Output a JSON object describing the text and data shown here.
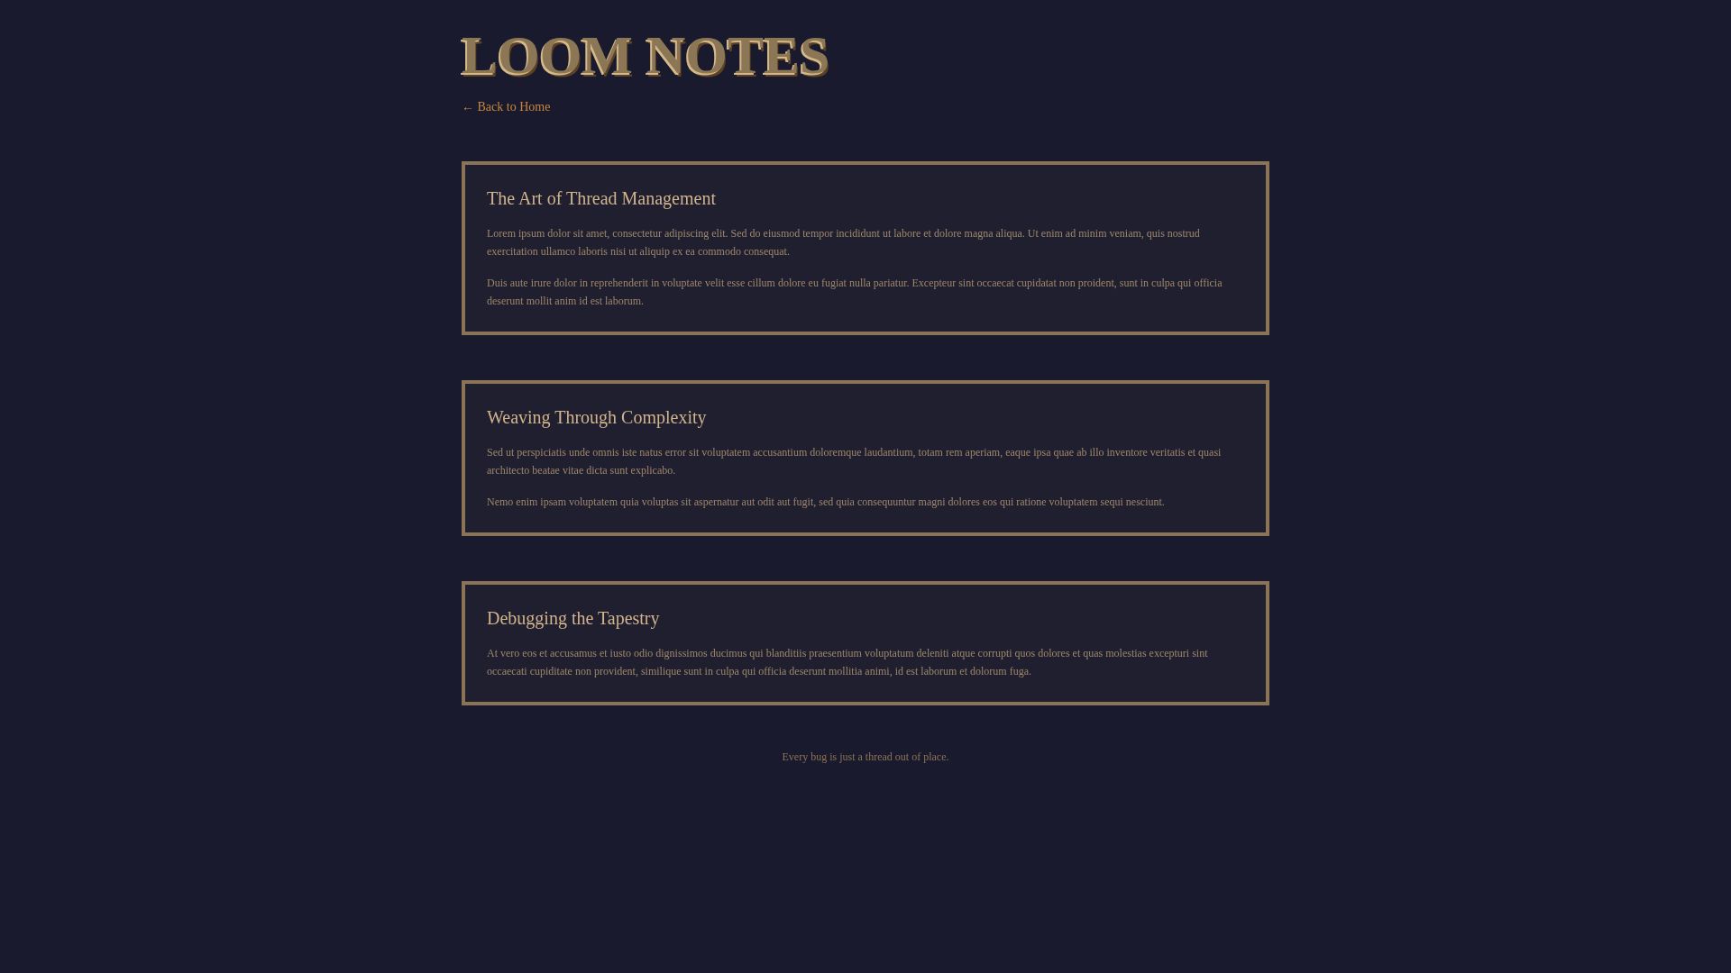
{
  "header": {
    "title": "LOOM NOTES",
    "back_link": "← Back to Home"
  },
  "cards": [
    {
      "title": "The Art of Thread Management",
      "paragraphs": [
        "Lorem ipsum dolor sit amet, consectetur adipiscing elit. Sed do eiusmod tempor incididunt ut labore et dolore magna aliqua. Ut enim ad minim veniam, quis nostrud exercitation ullamco laboris nisi ut aliquip ex ea commodo consequat.",
        "Duis aute irure dolor in reprehenderit in voluptate velit esse cillum dolore eu fugiat nulla pariatur. Excepteur sint occaecat cupidatat non proident, sunt in culpa qui officia deserunt mollit anim id est laborum."
      ]
    },
    {
      "title": "Weaving Through Complexity",
      "paragraphs": [
        "Sed ut perspiciatis unde omnis iste natus error sit voluptatem accusantium doloremque laudantium, totam rem aperiam, eaque ipsa quae ab illo inventore veritatis et quasi architecto beatae vitae dicta sunt explicabo.",
        "Nemo enim ipsam voluptatem quia voluptas sit aspernatur aut odit aut fugit, sed quia consequuntur magni dolores eos qui ratione voluptatem sequi nesciunt."
      ]
    },
    {
      "title": "Debugging the Tapestry",
      "paragraphs": [
        "At vero eos et accusamus et iusto odio dignissimos ducimus qui blanditiis praesentium voluptatum deleniti atque corrupti quos dolores et quas molestias excepturi sint occaecati cupiditate non provident, similique sunt in culpa qui officia deserunt mollitia animi, id est laborum et dolorum fuga."
      ]
    }
  ],
  "footer": {
    "text": "Every bug is just a thread out of place."
  }
}
